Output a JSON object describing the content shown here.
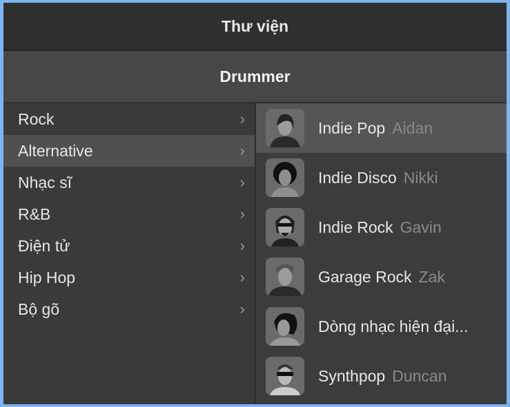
{
  "window": {
    "title": "Thư viện",
    "subtitle": "Drummer"
  },
  "categories": [
    {
      "label": "Rock",
      "selected": false
    },
    {
      "label": "Alternative",
      "selected": true
    },
    {
      "label": "Nhạc sĩ",
      "selected": false
    },
    {
      "label": "R&B",
      "selected": false
    },
    {
      "label": "Điện tử",
      "selected": false
    },
    {
      "label": "Hip Hop",
      "selected": false
    },
    {
      "label": "Bộ gõ",
      "selected": false
    }
  ],
  "drummers": [
    {
      "style": "Indie Pop",
      "name": "Aidan",
      "selected": true
    },
    {
      "style": "Indie Disco",
      "name": "Nikki",
      "selected": false
    },
    {
      "style": "Indie Rock",
      "name": "Gavin",
      "selected": false
    },
    {
      "style": "Garage Rock",
      "name": "Zak",
      "selected": false
    },
    {
      "style": "Dòng nhạc hiện đại...",
      "name": "",
      "selected": false
    },
    {
      "style": "Synthpop",
      "name": "Duncan",
      "selected": false
    }
  ],
  "icons": {
    "chevron": "›"
  }
}
